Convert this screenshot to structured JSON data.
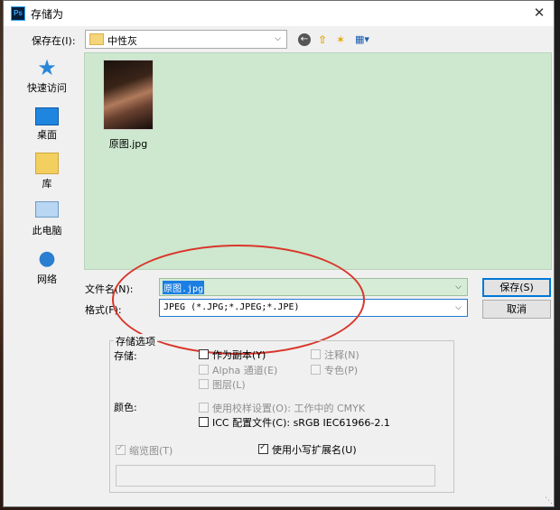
{
  "window": {
    "title": "存储为",
    "app_icon": "Ps",
    "close_glyph": "✕"
  },
  "toolbar": {
    "save_in_label": "保存在(I):",
    "save_in_value": "中性灰",
    "back_icon": "back-arrow-icon",
    "up_icon": "up-folder-icon",
    "new_folder_icon": "new-folder-icon",
    "view_icon": "view-menu-icon"
  },
  "places": [
    {
      "label": "快速访问",
      "icon": "star-icon"
    },
    {
      "label": "桌面",
      "icon": "desktop-icon"
    },
    {
      "label": "库",
      "icon": "library-icon"
    },
    {
      "label": "此电脑",
      "icon": "computer-icon"
    },
    {
      "label": "网络",
      "icon": "network-icon"
    }
  ],
  "files": [
    {
      "name": "原图.jpg"
    }
  ],
  "fields": {
    "filename_label": "文件名(N):",
    "filename_value": "原图.jpg",
    "format_label": "格式(F):",
    "format_value": "JPEG (*.JPG;*.JPEG;*.JPE)"
  },
  "buttons": {
    "save": "保存(S)",
    "cancel": "取消"
  },
  "options": {
    "group_title": "存储选项",
    "save_label": "存储:",
    "as_copy": "作为副本(Y)",
    "notes": "注释(N)",
    "alpha": "Alpha 通道(E)",
    "spot": "专色(P)",
    "layers": "图层(L)",
    "color_label": "颜色:",
    "use_proof": "使用校样设置(O): 工作中的 CMYK",
    "icc": "ICC 配置文件(C): sRGB IEC61966-2.1",
    "thumbnail": "缩览图(T)",
    "lowercase_ext": "使用小写扩展名(U)"
  },
  "colors": {
    "accent": "#0078d7",
    "file_area_bg": "#cde8cf",
    "annotation_circle": "#d9362b"
  }
}
